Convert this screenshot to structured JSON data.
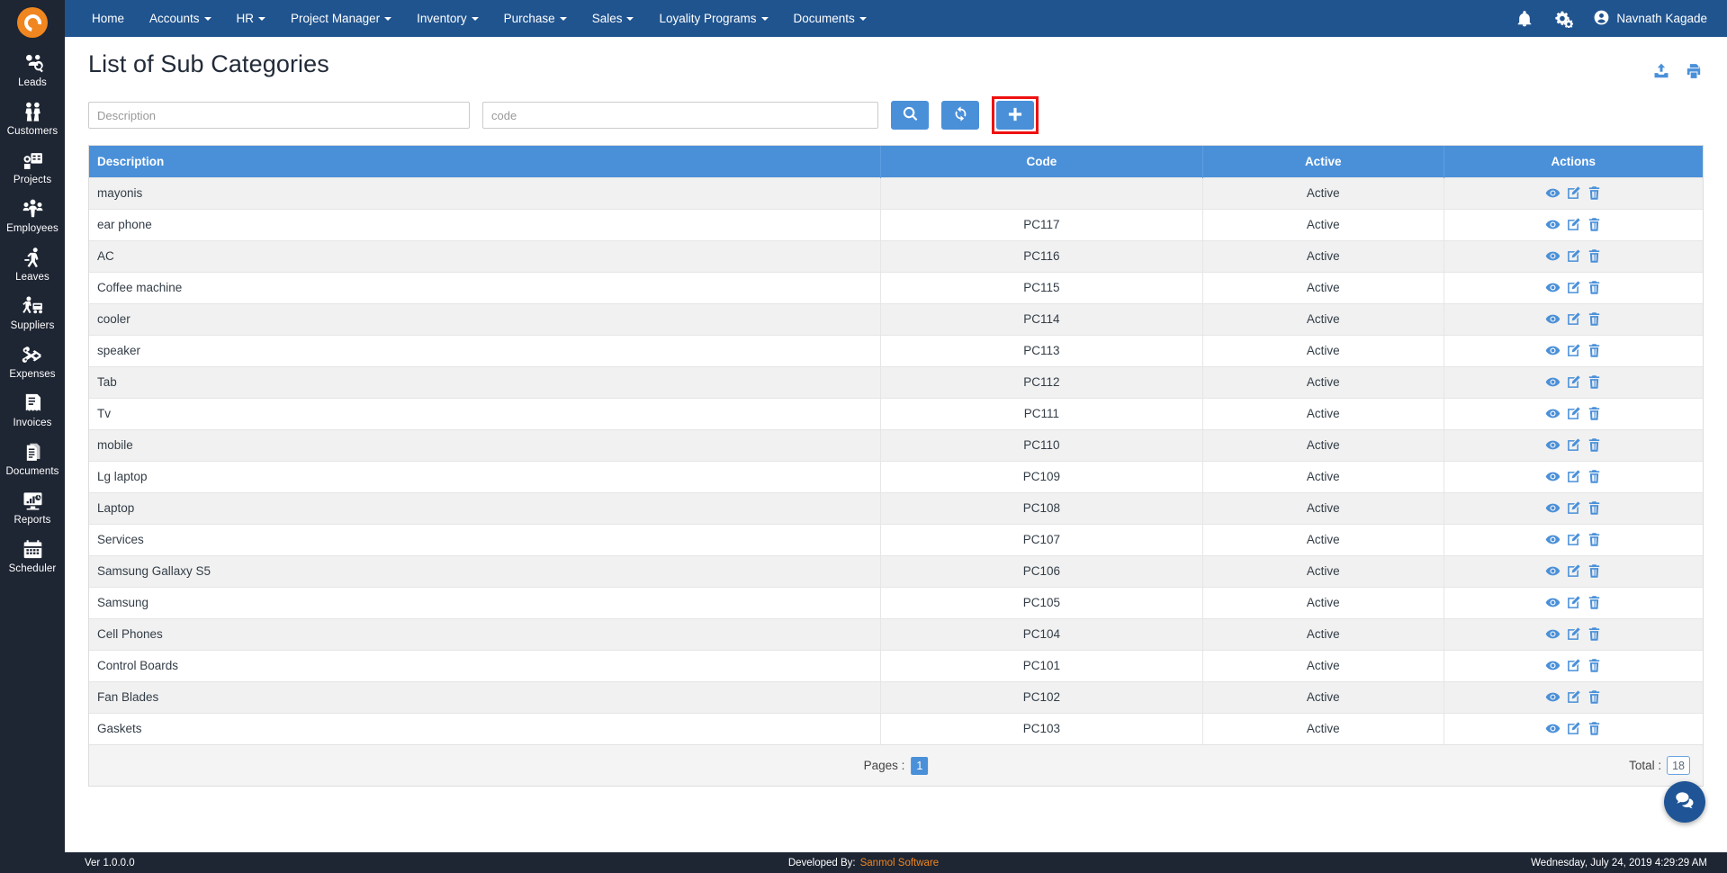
{
  "brand": {
    "logo_icon": "e-logo-icon"
  },
  "sidebar": {
    "items": [
      {
        "label": "Leads",
        "icon": "leads-icon"
      },
      {
        "label": "Customers",
        "icon": "customers-icon"
      },
      {
        "label": "Projects",
        "icon": "projects-icon"
      },
      {
        "label": "Employees",
        "icon": "employees-icon"
      },
      {
        "label": "Leaves",
        "icon": "leaves-icon"
      },
      {
        "label": "Suppliers",
        "icon": "suppliers-icon"
      },
      {
        "label": "Expenses",
        "icon": "expenses-icon"
      },
      {
        "label": "Invoices",
        "icon": "invoices-icon"
      },
      {
        "label": "Documents",
        "icon": "documents-icon"
      },
      {
        "label": "Reports",
        "icon": "reports-icon"
      },
      {
        "label": "Scheduler",
        "icon": "scheduler-icon"
      }
    ]
  },
  "topnav": {
    "items": [
      {
        "label": "Home",
        "has_caret": false
      },
      {
        "label": "Accounts",
        "has_caret": true
      },
      {
        "label": "HR",
        "has_caret": true
      },
      {
        "label": "Project Manager",
        "has_caret": true
      },
      {
        "label": "Inventory",
        "has_caret": true
      },
      {
        "label": "Purchase",
        "has_caret": true
      },
      {
        "label": "Sales",
        "has_caret": true
      },
      {
        "label": "Loyality Programs",
        "has_caret": true
      },
      {
        "label": "Documents",
        "has_caret": true
      }
    ],
    "notification_icon": "bell-icon",
    "settings_icon": "gears-icon",
    "user_icon": "user-circle-icon",
    "user_name": "Navnath Kagade"
  },
  "page": {
    "title": "List of Sub Categories",
    "export_icon": "upload-export-icon",
    "print_icon": "printer-icon"
  },
  "filters": {
    "description_placeholder": "Description",
    "description_value": "",
    "code_placeholder": "code",
    "code_value": "",
    "search_icon": "search-icon",
    "refresh_icon": "refresh-icon",
    "add_icon": "plus-icon"
  },
  "table": {
    "columns": [
      "Description",
      "Code",
      "Active",
      "Actions"
    ],
    "row_actions": {
      "view_icon": "eye-icon",
      "edit_icon": "edit-pencil-icon",
      "delete_icon": "trash-icon"
    },
    "rows": [
      {
        "description": "mayonis",
        "code": "",
        "active": "Active"
      },
      {
        "description": "ear phone",
        "code": "PC117",
        "active": "Active"
      },
      {
        "description": "AC",
        "code": "PC116",
        "active": "Active"
      },
      {
        "description": "Coffee machine",
        "code": "PC115",
        "active": "Active"
      },
      {
        "description": "cooler",
        "code": "PC114",
        "active": "Active"
      },
      {
        "description": "speaker",
        "code": "PC113",
        "active": "Active"
      },
      {
        "description": "Tab",
        "code": "PC112",
        "active": "Active"
      },
      {
        "description": "Tv",
        "code": "PC111",
        "active": "Active"
      },
      {
        "description": "mobile",
        "code": "PC110",
        "active": "Active"
      },
      {
        "description": "Lg laptop",
        "code": "PC109",
        "active": "Active"
      },
      {
        "description": "Laptop",
        "code": "PC108",
        "active": "Active"
      },
      {
        "description": "Services",
        "code": "PC107",
        "active": "Active"
      },
      {
        "description": "Samsung Gallaxy S5",
        "code": "PC106",
        "active": "Active"
      },
      {
        "description": "Samsung",
        "code": "PC105",
        "active": "Active"
      },
      {
        "description": "Cell Phones",
        "code": "PC104",
        "active": "Active"
      },
      {
        "description": "Control Boards",
        "code": "PC101",
        "active": "Active"
      },
      {
        "description": "Fan Blades",
        "code": "PC102",
        "active": "Active"
      },
      {
        "description": "Gaskets",
        "code": "PC103",
        "active": "Active"
      }
    ]
  },
  "footer": {
    "pages_label": "Pages :",
    "current_page": "1",
    "total_label": "Total :",
    "total_count": "18"
  },
  "chat": {
    "icon": "chat-bubbles-icon"
  },
  "statusbar": {
    "version": "Ver 1.0.0.0",
    "developed_label": "Developed By:",
    "developer": "Sanmol Software",
    "timestamp": "Wednesday, July 24, 2019 4:29:29 AM"
  },
  "colors": {
    "sidebar_bg": "#1e2533",
    "topnav_bg": "#20548f",
    "accent_blue": "#4a90d9",
    "highlight_red": "#ee1111",
    "brand_orange": "#f0861f"
  }
}
